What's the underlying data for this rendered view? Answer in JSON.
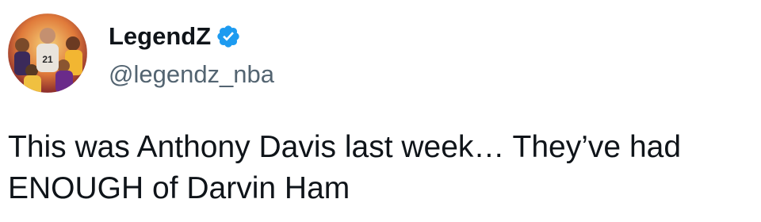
{
  "user": {
    "display_name": "LegendZ",
    "handle": "@legendz_nba",
    "verified": true,
    "avatar_icon": "avatar-illustration-basketball-players"
  },
  "tweet": {
    "text": "This was Anthony Davis last week… They’ve had ENOUGH of Darvin Ham"
  },
  "colors": {
    "text_primary": "#0f1419",
    "text_secondary": "#536471",
    "verified_blue": "#1d9bf0"
  }
}
